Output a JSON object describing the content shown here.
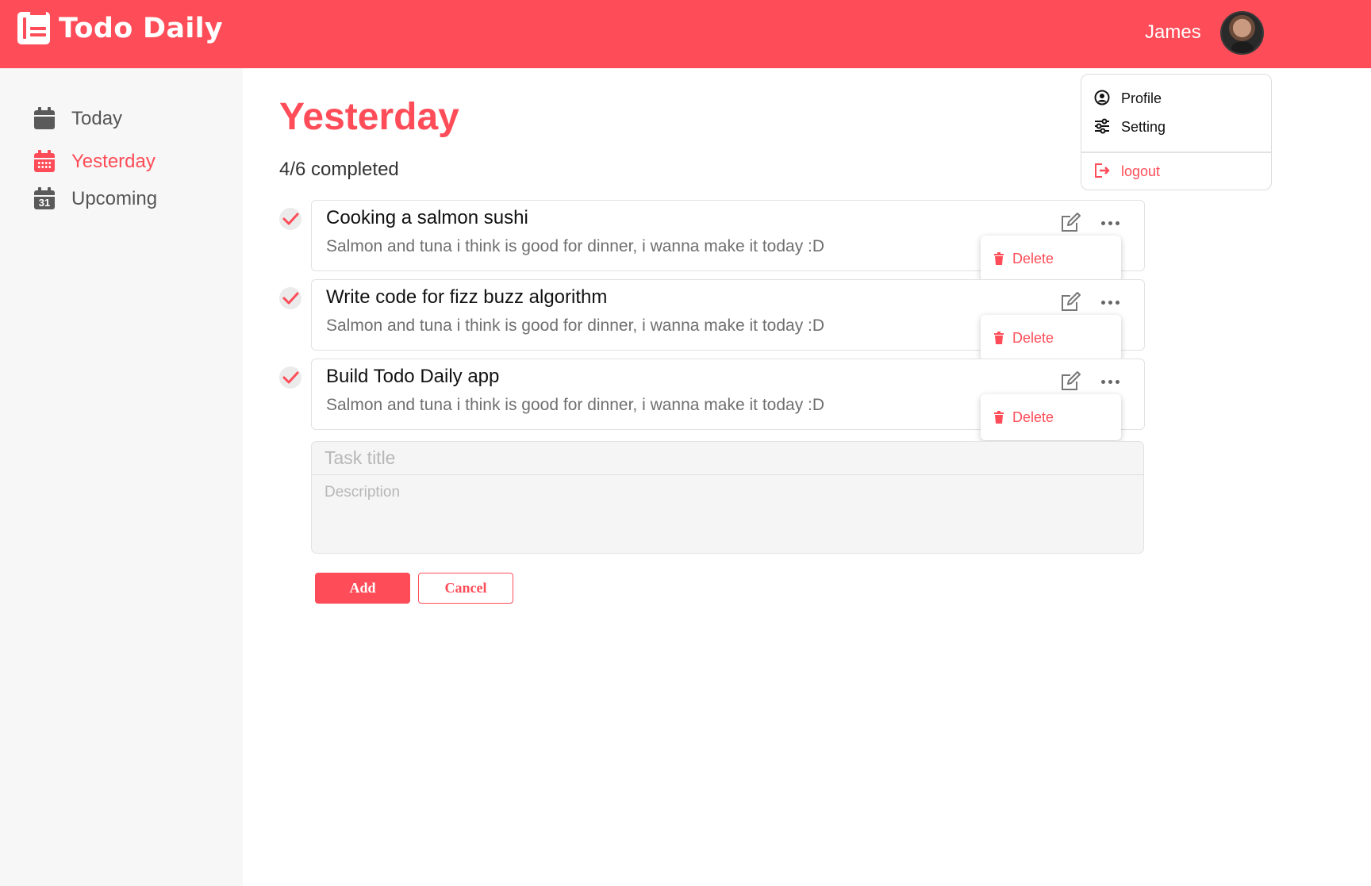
{
  "app": {
    "name": "Todo Daily"
  },
  "user": {
    "name": "James"
  },
  "colors": {
    "accent": "#fe4d58",
    "sidebar_bg": "#f7f7f7"
  },
  "sidebar": {
    "items": [
      {
        "label": "Today",
        "icon": "calendar-icon",
        "active": false
      },
      {
        "label": "Yesterday",
        "icon": "calendar-grid-icon",
        "active": true
      },
      {
        "label": "Upcoming",
        "icon": "calendar-31-icon",
        "active": false,
        "icon_text": "31"
      }
    ]
  },
  "main": {
    "title": "Yesterday",
    "progress": "4/6 completed",
    "tasks": [
      {
        "title": "Cooking a salmon sushi",
        "description": "Salmon and tuna i think is good for dinner, i wanna make it today :D",
        "completed": true
      },
      {
        "title": "Write code for fizz buzz algorithm",
        "description": "Salmon and tuna i think is good for dinner, i wanna make it today :D",
        "completed": true
      },
      {
        "title": "Build Todo Daily app",
        "description": "Salmon and tuna i think is good for dinner, i wanna make it today :D",
        "completed": true
      }
    ],
    "task_menu": {
      "delete_label": "Delete"
    },
    "form": {
      "title_placeholder": "Task title",
      "description_placeholder": "Description",
      "add_label": "Add",
      "cancel_label": "Cancel"
    }
  },
  "profile_menu": {
    "profile_label": "Profile",
    "setting_label": "Setting",
    "logout_label": "logout"
  }
}
